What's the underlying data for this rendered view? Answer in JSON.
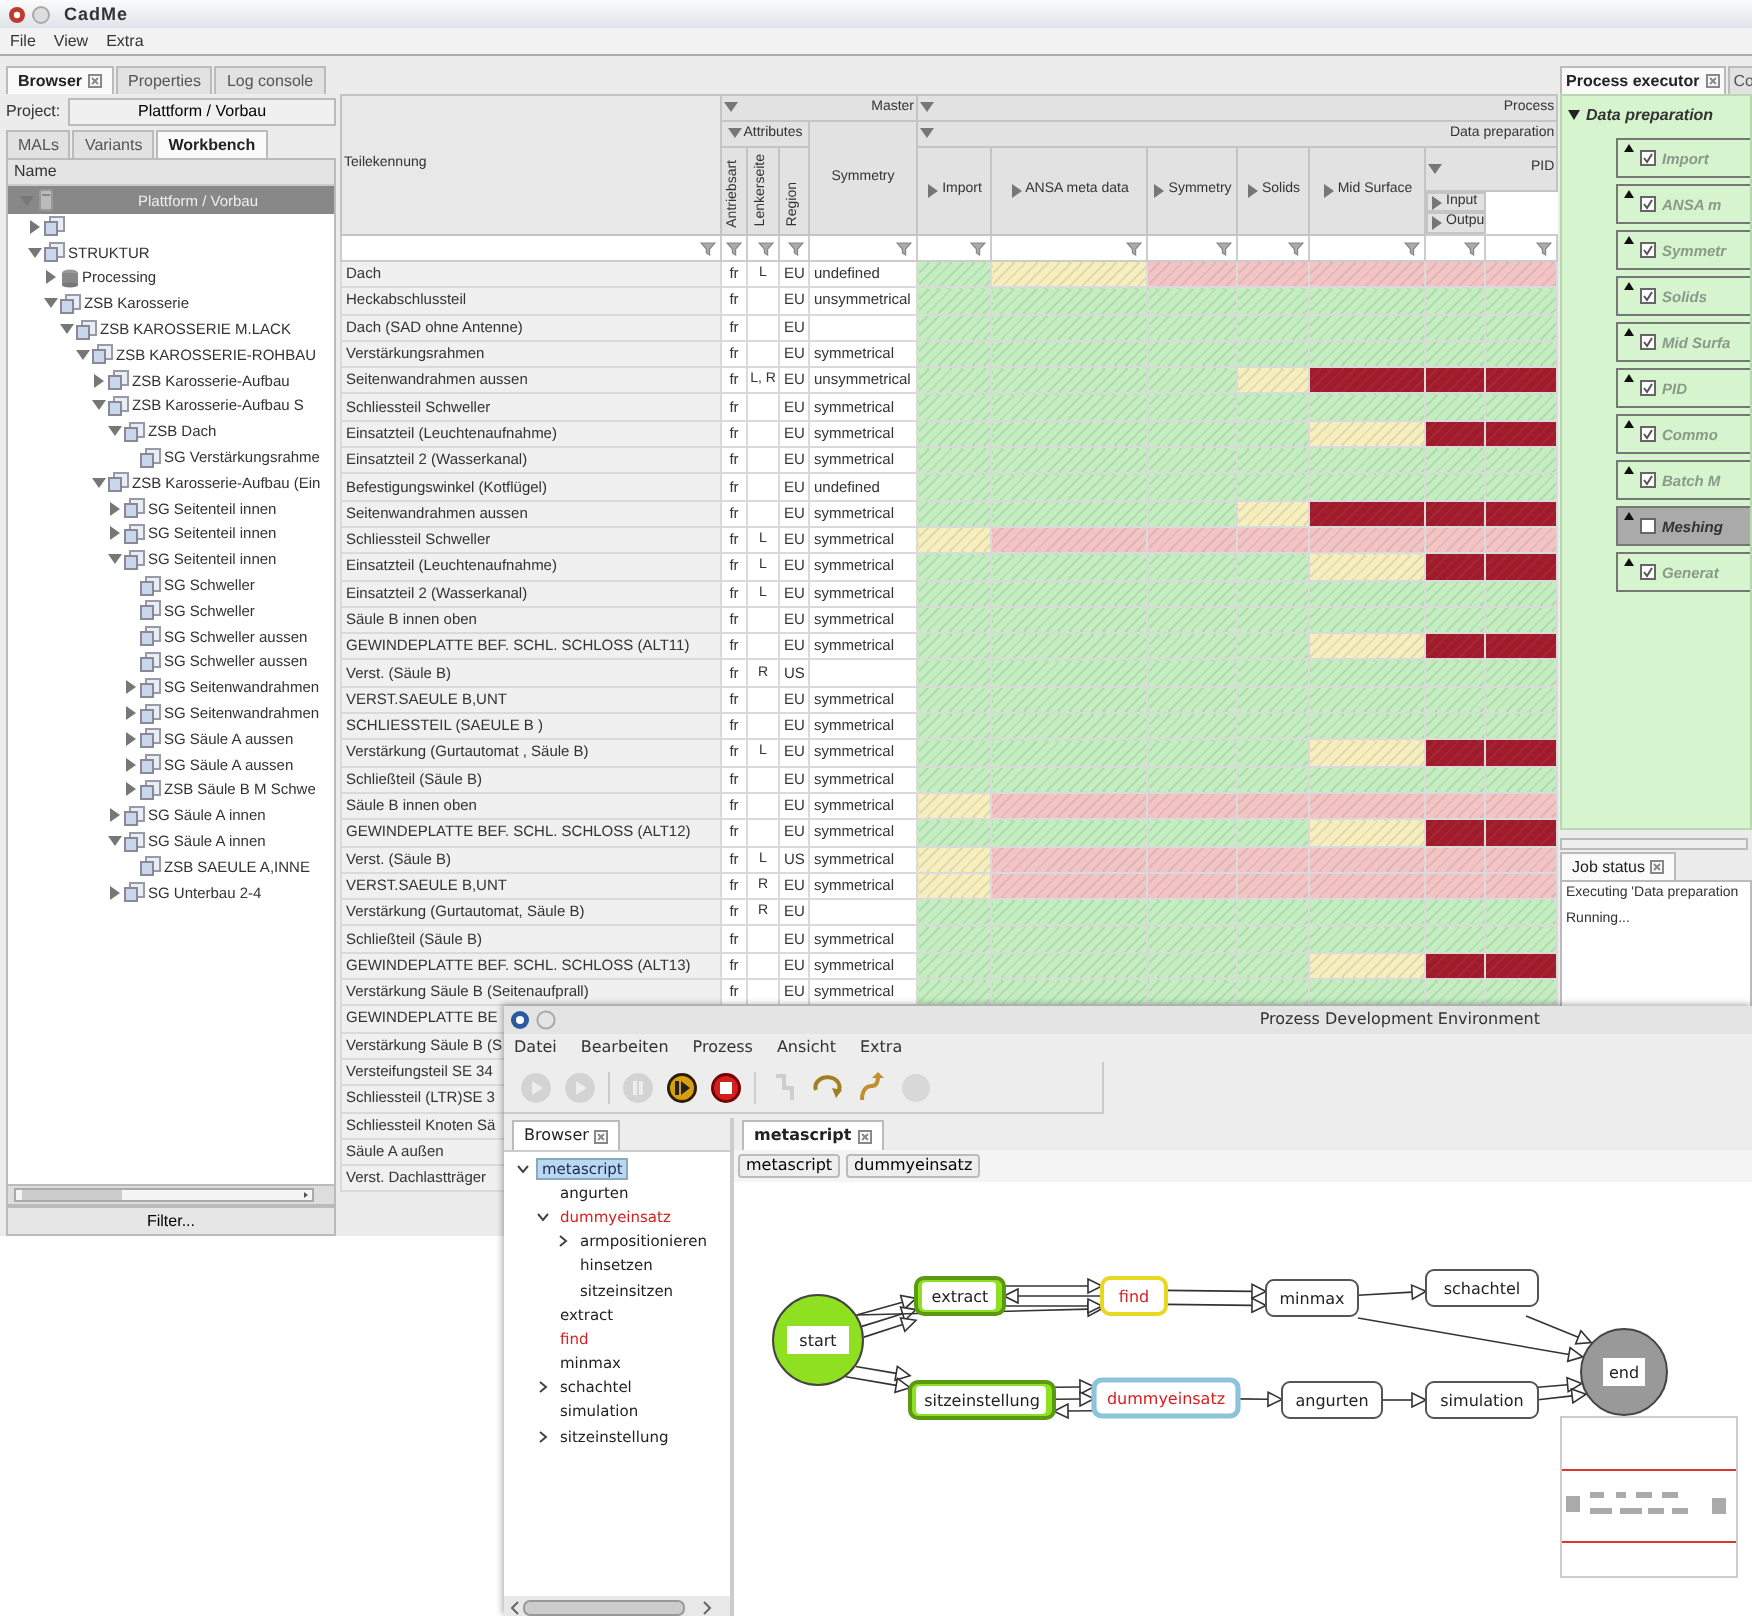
{
  "cadme": {
    "title": "CadMe",
    "menu": [
      "File",
      "View",
      "Extra"
    ],
    "tabs": [
      {
        "label": "Browser",
        "selected": true,
        "closable": true
      },
      {
        "label": "Properties",
        "selected": false,
        "closable": false
      },
      {
        "label": "Log console",
        "selected": false,
        "closable": false
      }
    ],
    "project": {
      "label": "Project:",
      "value": "Plattform / Vorbau"
    },
    "subtabs": [
      {
        "label": "MALs",
        "selected": false
      },
      {
        "label": "Variants",
        "selected": false
      },
      {
        "label": "Workbench",
        "selected": true
      }
    ],
    "tree_header": "Name",
    "tree": {
      "label": "Plattform / Vorbau",
      "kind": "root",
      "selected": true,
      "expanded": true,
      "children": [
        {
          "kind": "assembly",
          "selected": false,
          "expanded": false
        },
        {
          "label": "STRUKTUR",
          "kind": "assembly",
          "selected": false,
          "expanded": true,
          "children": [
            {
              "label": "Processing",
              "kind": "database",
              "selected": false,
              "expanded": false
            },
            {
              "label": "ZSB Karosserie",
              "kind": "assembly",
              "selected": false,
              "expanded": true,
              "children": [
                {
                  "label": "ZSB KAROSSERIE M.LACK",
                  "kind": "assembly",
                  "selected": false,
                  "expanded": true,
                  "children": [
                    {
                      "label": "ZSB KAROSSERIE-ROHBAU",
                      "kind": "assembly",
                      "selected": false,
                      "expanded": true,
                      "children": [
                        {
                          "label": "ZSB Karosserie-Aufbau",
                          "kind": "assembly",
                          "selected": false,
                          "expanded": false
                        },
                        {
                          "label": "ZSB Karosserie-Aufbau S",
                          "kind": "assembly",
                          "selected": false,
                          "expanded": true,
                          "children": [
                            {
                              "label": "ZSB Dach",
                              "kind": "assembly",
                              "selected": false,
                              "expanded": true,
                              "children": [
                                {
                                  "label": "SG Verstärkungsrahme",
                                  "kind": "assembly",
                                  "selected": false
                                }
                              ]
                            }
                          ]
                        },
                        {
                          "label": "ZSB Karosserie-Aufbau (Ein",
                          "kind": "assembly",
                          "selected": false,
                          "expanded": true,
                          "children": [
                            {
                              "label": "SG Seitenteil innen",
                              "kind": "assembly",
                              "selected": false,
                              "expanded": false
                            },
                            {
                              "label": "SG Seitenteil innen",
                              "kind": "assembly",
                              "selected": false,
                              "expanded": false
                            },
                            {
                              "label": "SG Seitenteil innen",
                              "kind": "assembly",
                              "selected": false,
                              "expanded": true,
                              "children": [
                                {
                                  "label": "SG Schweller",
                                  "kind": "assembly",
                                  "selected": false
                                },
                                {
                                  "label": "SG Schweller",
                                  "kind": "assembly",
                                  "selected": false
                                },
                                {
                                  "label": "SG Schweller aussen",
                                  "kind": "assembly",
                                  "selected": false
                                },
                                {
                                  "label": "SG Schweller aussen",
                                  "kind": "assembly",
                                  "selected": false
                                },
                                {
                                  "label": "SG Seitenwandrahmen",
                                  "kind": "assembly",
                                  "selected": false,
                                  "expanded": false
                                },
                                {
                                  "label": "SG Seitenwandrahmen",
                                  "kind": "assembly",
                                  "selected": false,
                                  "expanded": false
                                },
                                {
                                  "label": "SG Säule A aussen",
                                  "kind": "assembly",
                                  "selected": false,
                                  "expanded": false
                                },
                                {
                                  "label": "SG Säule A aussen",
                                  "kind": "assembly",
                                  "selected": false,
                                  "expanded": false
                                },
                                {
                                  "label": "ZSB Säule B M Schwe",
                                  "kind": "assembly",
                                  "selected": false,
                                  "expanded": false
                                }
                              ]
                            },
                            {
                              "label": "SG Säule A innen",
                              "kind": "assembly",
                              "selected": false,
                              "expanded": false
                            },
                            {
                              "label": "SG Säule A innen",
                              "kind": "assembly",
                              "selected": false,
                              "expanded": true,
                              "children": [
                                {
                                  "label": "ZSB SAEULE A,INNE",
                                  "kind": "assembly",
                                  "selected": false
                                }
                              ]
                            },
                            {
                              "label": "SG Unterbau 2-4",
                              "kind": "assembly",
                              "selected": false,
                              "expanded": false
                            }
                          ]
                        }
                      ]
                    }
                  ]
                }
              ]
            }
          ]
        }
      ]
    },
    "filter_button": "Filter...",
    "table": {
      "header": {
        "name": "Teilekennung",
        "master": {
          "label": "Master",
          "expanded": true
        },
        "attributes": {
          "label": "Attributes",
          "expanded": true
        },
        "attribute_columns": [
          "Antriebsart",
          "Lenkerseite",
          "Region"
        ],
        "symmetry": "Symmetry",
        "process": {
          "label": "Process",
          "expanded": true
        },
        "data_preparation": {
          "label": "Data preparation",
          "expanded": true
        },
        "steps": [
          {
            "label": "Import",
            "expanded": false
          },
          {
            "label": "ANSA meta data",
            "expanded": false
          },
          {
            "label": "Symmetry",
            "expanded": false
          },
          {
            "label": "Solids",
            "expanded": false
          },
          {
            "label": "Mid Surface",
            "expanded": false
          }
        ],
        "pid": {
          "label": "PID",
          "expanded": true
        },
        "pid_columns": [
          {
            "label": "Input",
            "expanded": false
          },
          {
            "label": "Outpu",
            "expanded": false
          }
        ]
      },
      "rows": [
        {
          "name": "Dach",
          "drive": "fr",
          "side": "L",
          "region": "EU",
          "symmetry": "undefined",
          "cells": [
            {
              "color": "#c2eec0"
            },
            {
              "color": "#f6efbd"
            },
            {
              "color": "#f4c4c4"
            },
            {
              "color": "#f4c4c4"
            },
            {
              "color": "#f4c4c4"
            },
            {
              "color": "#f4c4c4"
            },
            {
              "color": "#f4c4c4"
            }
          ]
        },
        {
          "name": "Heckabschlussteil",
          "drive": "fr",
          "region": "EU",
          "symmetry": "unsymmetrical",
          "cells": [
            {
              "color": "#c2eec0"
            },
            {
              "color": "#c2eec0"
            },
            {
              "color": "#c2eec0"
            },
            {
              "color": "#c2eec0"
            },
            {
              "color": "#c2eec0"
            },
            {
              "color": "#c2eec0"
            },
            {
              "color": "#c2eec0"
            }
          ]
        },
        {
          "name": "Dach (SAD ohne Antenne)",
          "drive": "fr",
          "region": "EU",
          "cells": [
            {
              "color": "#c2eec0"
            },
            {
              "color": "#c2eec0"
            },
            {
              "color": "#c2eec0"
            },
            {
              "color": "#c2eec0"
            },
            {
              "color": "#c2eec0"
            },
            {
              "color": "#c2eec0"
            },
            {
              "color": "#c2eec0"
            }
          ]
        },
        {
          "name": "Verstärkungsrahmen",
          "drive": "fr",
          "region": "EU",
          "symmetry": "symmetrical",
          "cells": [
            {
              "color": "#c2eec0"
            },
            {
              "color": "#c2eec0"
            },
            {
              "color": "#c2eec0"
            },
            {
              "color": "#c2eec0"
            },
            {
              "color": "#c2eec0"
            },
            {
              "color": "#c2eec0"
            },
            {
              "color": "#c2eec0"
            }
          ]
        },
        {
          "name": "Seitenwandrahmen aussen",
          "drive": "fr",
          "side": "L, R",
          "region": "EU",
          "symmetry": "unsymmetrical",
          "cells": [
            {
              "color": "#c2eec0"
            },
            {
              "color": "#c2eec0"
            },
            {
              "color": "#c2eec0"
            },
            {
              "color": "#f6efbd"
            },
            {
              "color": "#a31a2a"
            },
            {
              "color": "#a31a2a"
            },
            {
              "color": "#a31a2a"
            }
          ]
        },
        {
          "name": "Schliessteil Schweller",
          "drive": "fr",
          "region": "EU",
          "symmetry": "symmetrical",
          "cells": [
            {
              "color": "#c2eec0"
            },
            {
              "color": "#c2eec0"
            },
            {
              "color": "#c2eec0"
            },
            {
              "color": "#c2eec0"
            },
            {
              "color": "#c2eec0"
            },
            {
              "color": "#c2eec0"
            },
            {
              "color": "#c2eec0"
            }
          ]
        },
        {
          "name": "Einsatzteil (Leuchtenaufnahme)",
          "drive": "fr",
          "region": "EU",
          "symmetry": "symmetrical",
          "cells": [
            {
              "color": "#c2eec0"
            },
            {
              "color": "#c2eec0"
            },
            {
              "color": "#c2eec0"
            },
            {
              "color": "#c2eec0"
            },
            {
              "color": "#f6efbd"
            },
            {
              "color": "#a31a2a"
            },
            {
              "color": "#a31a2a"
            }
          ]
        },
        {
          "name": "Einsatzteil 2 (Wasserkanal)",
          "drive": "fr",
          "region": "EU",
          "symmetry": "symmetrical",
          "cells": [
            {
              "color": "#c2eec0"
            },
            {
              "color": "#c2eec0"
            },
            {
              "color": "#c2eec0"
            },
            {
              "color": "#c2eec0"
            },
            {
              "color": "#c2eec0"
            },
            {
              "color": "#c2eec0"
            },
            {
              "color": "#c2eec0"
            }
          ]
        },
        {
          "name": "Befestigungswinkel (Kotflügel)",
          "drive": "fr",
          "region": "EU",
          "symmetry": "undefined",
          "cells": [
            {
              "color": "#c2eec0"
            },
            {
              "color": "#c2eec0"
            },
            {
              "color": "#c2eec0"
            },
            {
              "color": "#c2eec0"
            },
            {
              "color": "#c2eec0"
            },
            {
              "color": "#c2eec0"
            },
            {
              "color": "#c2eec0"
            }
          ]
        },
        {
          "name": "Seitenwandrahmen aussen",
          "drive": "fr",
          "region": "EU",
          "symmetry": "symmetrical",
          "cells": [
            {
              "color": "#c2eec0"
            },
            {
              "color": "#c2eec0"
            },
            {
              "color": "#c2eec0"
            },
            {
              "color": "#f6efbd"
            },
            {
              "color": "#a31a2a"
            },
            {
              "color": "#a31a2a"
            },
            {
              "color": "#a31a2a"
            }
          ]
        },
        {
          "name": "Schliessteil Schweller",
          "drive": "fr",
          "side": "L",
          "region": "EU",
          "symmetry": "symmetrical",
          "cells": [
            {
              "color": "#f6efbd"
            },
            {
              "color": "#f4c4c4"
            },
            {
              "color": "#f4c4c4"
            },
            {
              "color": "#f4c4c4"
            },
            {
              "color": "#f4c4c4"
            },
            {
              "color": "#f4c4c4"
            },
            {
              "color": "#f4c4c4"
            }
          ]
        },
        {
          "name": "Einsatzteil (Leuchtenaufnahme)",
          "drive": "fr",
          "side": "L",
          "region": "EU",
          "symmetry": "symmetrical",
          "cells": [
            {
              "color": "#c2eec0"
            },
            {
              "color": "#c2eec0"
            },
            {
              "color": "#c2eec0"
            },
            {
              "color": "#c2eec0"
            },
            {
              "color": "#f6efbd"
            },
            {
              "color": "#a31a2a"
            },
            {
              "color": "#a31a2a"
            }
          ]
        },
        {
          "name": "Einsatzteil 2 (Wasserkanal)",
          "drive": "fr",
          "side": "L",
          "region": "EU",
          "symmetry": "symmetrical",
          "cells": [
            {
              "color": "#c2eec0"
            },
            {
              "color": "#c2eec0"
            },
            {
              "color": "#c2eec0"
            },
            {
              "color": "#c2eec0"
            },
            {
              "color": "#c2eec0"
            },
            {
              "color": "#c2eec0"
            },
            {
              "color": "#c2eec0"
            }
          ]
        },
        {
          "name": "Säule B innen oben",
          "drive": "fr",
          "region": "EU",
          "symmetry": "symmetrical",
          "cells": [
            {
              "color": "#c2eec0"
            },
            {
              "color": "#c2eec0"
            },
            {
              "color": "#c2eec0"
            },
            {
              "color": "#c2eec0"
            },
            {
              "color": "#c2eec0"
            },
            {
              "color": "#c2eec0"
            },
            {
              "color": "#c2eec0"
            }
          ]
        },
        {
          "name": "GEWINDEPLATTE BEF. SCHL. SCHLOSS (ALT11)",
          "drive": "fr",
          "region": "EU",
          "symmetry": "symmetrical",
          "cells": [
            {
              "color": "#c2eec0"
            },
            {
              "color": "#c2eec0"
            },
            {
              "color": "#c2eec0"
            },
            {
              "color": "#c2eec0"
            },
            {
              "color": "#f6efbd"
            },
            {
              "color": "#a31a2a"
            },
            {
              "color": "#a31a2a"
            }
          ]
        },
        {
          "name": "Verst. (Säule B)",
          "drive": "fr",
          "side": "R",
          "region": "US",
          "cells": [
            {
              "color": "#c2eec0"
            },
            {
              "color": "#c2eec0"
            },
            {
              "color": "#c2eec0"
            },
            {
              "color": "#c2eec0"
            },
            {
              "color": "#c2eec0"
            },
            {
              "color": "#c2eec0"
            },
            {
              "color": "#c2eec0"
            }
          ]
        },
        {
          "name": "VERST.SAEULE B,UNT",
          "drive": "fr",
          "region": "EU",
          "symmetry": "symmetrical",
          "cells": [
            {
              "color": "#c2eec0"
            },
            {
              "color": "#c2eec0"
            },
            {
              "color": "#c2eec0"
            },
            {
              "color": "#c2eec0"
            },
            {
              "color": "#c2eec0"
            },
            {
              "color": "#c2eec0"
            },
            {
              "color": "#c2eec0"
            }
          ]
        },
        {
          "name": "SCHLIESSTEIL (SAEULE B )",
          "drive": "fr",
          "region": "EU",
          "symmetry": "symmetrical",
          "cells": [
            {
              "color": "#c2eec0"
            },
            {
              "color": "#c2eec0"
            },
            {
              "color": "#c2eec0"
            },
            {
              "color": "#c2eec0"
            },
            {
              "color": "#c2eec0"
            },
            {
              "color": "#c2eec0"
            },
            {
              "color": "#c2eec0"
            }
          ]
        },
        {
          "name": "Verstärkung (Gurtautomat , Säule B)",
          "drive": "fr",
          "side": "L",
          "region": "EU",
          "symmetry": "symmetrical",
          "cells": [
            {
              "color": "#c2eec0"
            },
            {
              "color": "#c2eec0"
            },
            {
              "color": "#c2eec0"
            },
            {
              "color": "#c2eec0"
            },
            {
              "color": "#f6efbd"
            },
            {
              "color": "#a31a2a"
            },
            {
              "color": "#a31a2a"
            }
          ]
        },
        {
          "name": "Schließteil (Säule B)",
          "drive": "fr",
          "region": "EU",
          "symmetry": "symmetrical",
          "cells": [
            {
              "color": "#c2eec0"
            },
            {
              "color": "#c2eec0"
            },
            {
              "color": "#c2eec0"
            },
            {
              "color": "#c2eec0"
            },
            {
              "color": "#c2eec0"
            },
            {
              "color": "#c2eec0"
            },
            {
              "color": "#c2eec0"
            }
          ]
        },
        {
          "name": "Säule B innen oben",
          "drive": "fr",
          "region": "EU",
          "symmetry": "symmetrical",
          "cells": [
            {
              "color": "#f6efbd"
            },
            {
              "color": "#f4c4c4"
            },
            {
              "color": "#f4c4c4"
            },
            {
              "color": "#f4c4c4"
            },
            {
              "color": "#f4c4c4"
            },
            {
              "color": "#f4c4c4"
            },
            {
              "color": "#f4c4c4"
            }
          ]
        },
        {
          "name": "GEWINDEPLATTE BEF. SCHL. SCHLOSS (ALT12)",
          "drive": "fr",
          "region": "EU",
          "symmetry": "symmetrical",
          "cells": [
            {
              "color": "#c2eec0"
            },
            {
              "color": "#c2eec0"
            },
            {
              "color": "#c2eec0"
            },
            {
              "color": "#c2eec0"
            },
            {
              "color": "#f6efbd"
            },
            {
              "color": "#a31a2a"
            },
            {
              "color": "#a31a2a"
            }
          ]
        },
        {
          "name": "Verst. (Säule B)",
          "drive": "fr",
          "side": "L",
          "region": "US",
          "symmetry": "symmetrical",
          "cells": [
            {
              "color": "#f6efbd"
            },
            {
              "color": "#f4c4c4"
            },
            {
              "color": "#f4c4c4"
            },
            {
              "color": "#f4c4c4"
            },
            {
              "color": "#f4c4c4"
            },
            {
              "color": "#f4c4c4"
            },
            {
              "color": "#f4c4c4"
            }
          ]
        },
        {
          "name": "VERST.SAEULE B,UNT",
          "drive": "fr",
          "side": "R",
          "region": "EU",
          "symmetry": "symmetrical",
          "cells": [
            {
              "color": "#f6efbd"
            },
            {
              "color": "#f4c4c4"
            },
            {
              "color": "#f4c4c4"
            },
            {
              "color": "#f4c4c4"
            },
            {
              "color": "#f4c4c4"
            },
            {
              "color": "#f4c4c4"
            },
            {
              "color": "#f4c4c4"
            }
          ]
        },
        {
          "name": "Verstärkung (Gurtautomat, Säule B)",
          "drive": "fr",
          "side": "R",
          "region": "EU",
          "cells": [
            {
              "color": "#c2eec0"
            },
            {
              "color": "#c2eec0"
            },
            {
              "color": "#c2eec0"
            },
            {
              "color": "#c2eec0"
            },
            {
              "color": "#c2eec0"
            },
            {
              "color": "#c2eec0"
            },
            {
              "color": "#c2eec0"
            }
          ]
        },
        {
          "name": "Schließteil (Säule B)",
          "drive": "fr",
          "region": "EU",
          "symmetry": "symmetrical",
          "cells": [
            {
              "color": "#c2eec0"
            },
            {
              "color": "#c2eec0"
            },
            {
              "color": "#c2eec0"
            },
            {
              "color": "#c2eec0"
            },
            {
              "color": "#c2eec0"
            },
            {
              "color": "#c2eec0"
            },
            {
              "color": "#c2eec0"
            }
          ]
        },
        {
          "name": "GEWINDEPLATTE BEF. SCHL. SCHLOSS (ALT13)",
          "drive": "fr",
          "region": "EU",
          "symmetry": "symmetrical",
          "cells": [
            {
              "color": "#c2eec0"
            },
            {
              "color": "#c2eec0"
            },
            {
              "color": "#c2eec0"
            },
            {
              "color": "#c2eec0"
            },
            {
              "color": "#f6efbd"
            },
            {
              "color": "#a31a2a"
            },
            {
              "color": "#a31a2a"
            }
          ]
        },
        {
          "name": "Verstärkung Säule B (Seitenaufprall)",
          "drive": "fr",
          "region": "EU",
          "symmetry": "symmetrical",
          "cells": [
            {
              "color": "#c2eec0"
            },
            {
              "color": "#c2eec0"
            },
            {
              "color": "#c2eec0"
            },
            {
              "color": "#c2eec0"
            },
            {
              "color": "#c2eec0"
            },
            {
              "color": "#c2eec0"
            },
            {
              "color": "#c2eec0"
            }
          ]
        },
        {
          "name": "GEWINDEPLATTE BE"
        },
        {
          "name": "Verstärkung Säule B (S"
        },
        {
          "name": "Versteifungsteil SE 34"
        },
        {
          "name": "Schliessteil (LTR)SE 3"
        },
        {
          "name": "Schliessteil Knoten Sä"
        },
        {
          "name": "Säule A außen"
        },
        {
          "name": "Verst. Dachlastträger"
        }
      ]
    },
    "executor": {
      "tabs": [
        {
          "label": "Process executor",
          "selected": true
        },
        {
          "label": "Co",
          "selected": false
        }
      ],
      "group": {
        "label": "Data preparation",
        "expanded": true
      },
      "steps": [
        {
          "label": "Import",
          "checked": true
        },
        {
          "label": "ANSA m",
          "checked": true
        },
        {
          "label": "Symmetr",
          "checked": true
        },
        {
          "label": "Solids",
          "checked": true
        },
        {
          "label": "Mid Surfa",
          "checked": true
        },
        {
          "label": "PID",
          "checked": true
        },
        {
          "label": "Commo",
          "checked": true
        },
        {
          "label": "Batch M",
          "checked": true
        },
        {
          "label": "Meshing",
          "checked": false
        },
        {
          "label": "Generat",
          "checked": true
        }
      ]
    },
    "job_status": {
      "tab": "Job status",
      "lines": [
        "Executing 'Data preparation",
        "Running..."
      ]
    }
  },
  "pde": {
    "title": "Prozess Development Environment",
    "menu": [
      "Datei",
      "Bearbeiten",
      "Prozess",
      "Ansicht",
      "Extra"
    ],
    "toolbar": [
      {
        "kind": "run",
        "disabled": true
      },
      {
        "kind": "step",
        "disabled": true
      },
      {
        "kind": "pause",
        "disabled": true
      },
      {
        "kind": "resume",
        "disabled": false
      },
      {
        "kind": "stop",
        "disabled": false
      },
      {
        "kind": "step-into",
        "disabled": true
      },
      {
        "kind": "step-over",
        "disabled": false
      },
      {
        "kind": "step-out",
        "disabled": false
      },
      {
        "kind": "record",
        "disabled": true
      }
    ],
    "browser_tab": "Browser",
    "tree": [
      {
        "label": "metascript",
        "selected": true,
        "color": "#1f2a44",
        "expanded": true,
        "children": [
          {
            "label": "angurten",
            "selected": false,
            "color": "#222222"
          },
          {
            "label": "dummyeinsatz",
            "selected": false,
            "color": "#d42020",
            "expanded": true,
            "children": [
              {
                "label": "armpositionieren",
                "selected": false,
                "color": "#222222",
                "expanded": false
              },
              {
                "label": "hinsetzen",
                "selected": false,
                "color": "#222222"
              },
              {
                "label": "sitzeinsitzen",
                "selected": false,
                "color": "#222222"
              }
            ]
          },
          {
            "label": "extract",
            "selected": false,
            "color": "#222222"
          },
          {
            "label": "find",
            "selected": false,
            "color": "#d42020"
          },
          {
            "label": "minmax",
            "selected": false,
            "color": "#222222"
          },
          {
            "label": "schachtel",
            "selected": false,
            "color": "#222222",
            "expanded": false
          },
          {
            "label": "simulation",
            "selected": false,
            "color": "#222222"
          },
          {
            "label": "sitzeinstellung",
            "selected": false,
            "color": "#222222",
            "expanded": false
          }
        ]
      }
    ],
    "editor_tab": "metascript",
    "breadcrumbs": [
      "metascript",
      "dummyeinsatz"
    ],
    "nodes": [
      {
        "label": "start",
        "kind": "start",
        "completed": true,
        "running": false,
        "selected": false,
        "color": "#222222"
      },
      {
        "label": "extract",
        "kind": "task",
        "completed": true,
        "running": false,
        "selected": false,
        "color": "#222222"
      },
      {
        "label": "find",
        "kind": "task",
        "completed": false,
        "running": true,
        "selected": false,
        "color": "#d42020"
      },
      {
        "label": "minmax",
        "kind": "task",
        "completed": false,
        "running": false,
        "selected": false,
        "color": "#222222"
      },
      {
        "label": "schachtel",
        "kind": "task",
        "completed": false,
        "running": false,
        "selected": false,
        "color": "#222222"
      },
      {
        "label": "end",
        "kind": "end",
        "completed": false,
        "running": false,
        "selected": false,
        "color": "#222222"
      },
      {
        "label": "sitzeinstellung",
        "kind": "task",
        "completed": true,
        "running": false,
        "selected": false,
        "color": "#222222"
      },
      {
        "label": "dummyeinsatz",
        "kind": "task",
        "completed": false,
        "running": false,
        "selected": true,
        "color": "#d42020"
      },
      {
        "label": "angurten",
        "kind": "task",
        "completed": false,
        "running": false,
        "selected": false,
        "color": "#222222"
      },
      {
        "label": "simulation",
        "kind": "task",
        "completed": false,
        "running": false,
        "selected": false,
        "color": "#222222"
      }
    ]
  }
}
